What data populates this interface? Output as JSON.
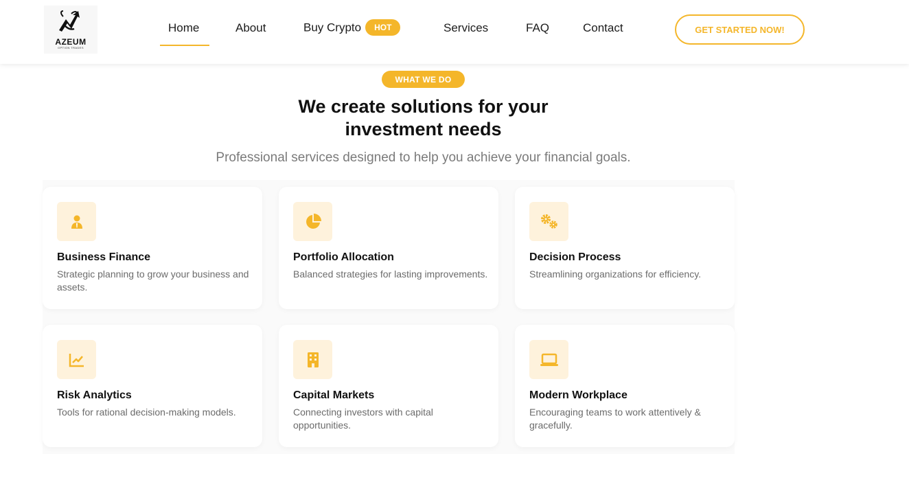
{
  "header": {
    "logo": {
      "name": "AZEUM",
      "sub": "OPTION TRADES"
    },
    "nav": [
      {
        "label": "Home"
      },
      {
        "label": "About"
      },
      {
        "label": "Buy Crypto",
        "badge": "HOT"
      },
      {
        "label": "Services"
      },
      {
        "label": "FAQ"
      },
      {
        "label": "Contact"
      }
    ],
    "active_nav": "Home",
    "cta_label": "GET STARTED NOW!"
  },
  "section": {
    "eyebrow": "WHAT WE DO",
    "title_line1": "We create solutions for your",
    "title_line2": "investment needs",
    "subtitle": "Professional services designed to help you achieve your financial goals."
  },
  "services": [
    {
      "icon": "user-tie-icon",
      "title": "Business Finance",
      "desc": "Strategic planning to grow your business and assets."
    },
    {
      "icon": "pie-chart-icon",
      "title": "Portfolio Allocation",
      "desc": "Balanced strategies for lasting improvements."
    },
    {
      "icon": "gears-icon",
      "title": "Decision Process",
      "desc": "Streamlining organizations for efficiency."
    },
    {
      "icon": "line-chart-icon",
      "title": "Risk Analytics",
      "desc": "Tools for rational decision-making models."
    },
    {
      "icon": "building-icon",
      "title": "Capital Markets",
      "desc": "Connecting investors with capital opportunities."
    },
    {
      "icon": "laptop-icon",
      "title": "Modern Workplace",
      "desc": "Encouraging teams to work attentively & gracefully."
    }
  ],
  "colors": {
    "accent": "#f4b62a",
    "icon_bg": "#fef2dc",
    "text": "#111111",
    "muted": "#6b6b6b"
  }
}
